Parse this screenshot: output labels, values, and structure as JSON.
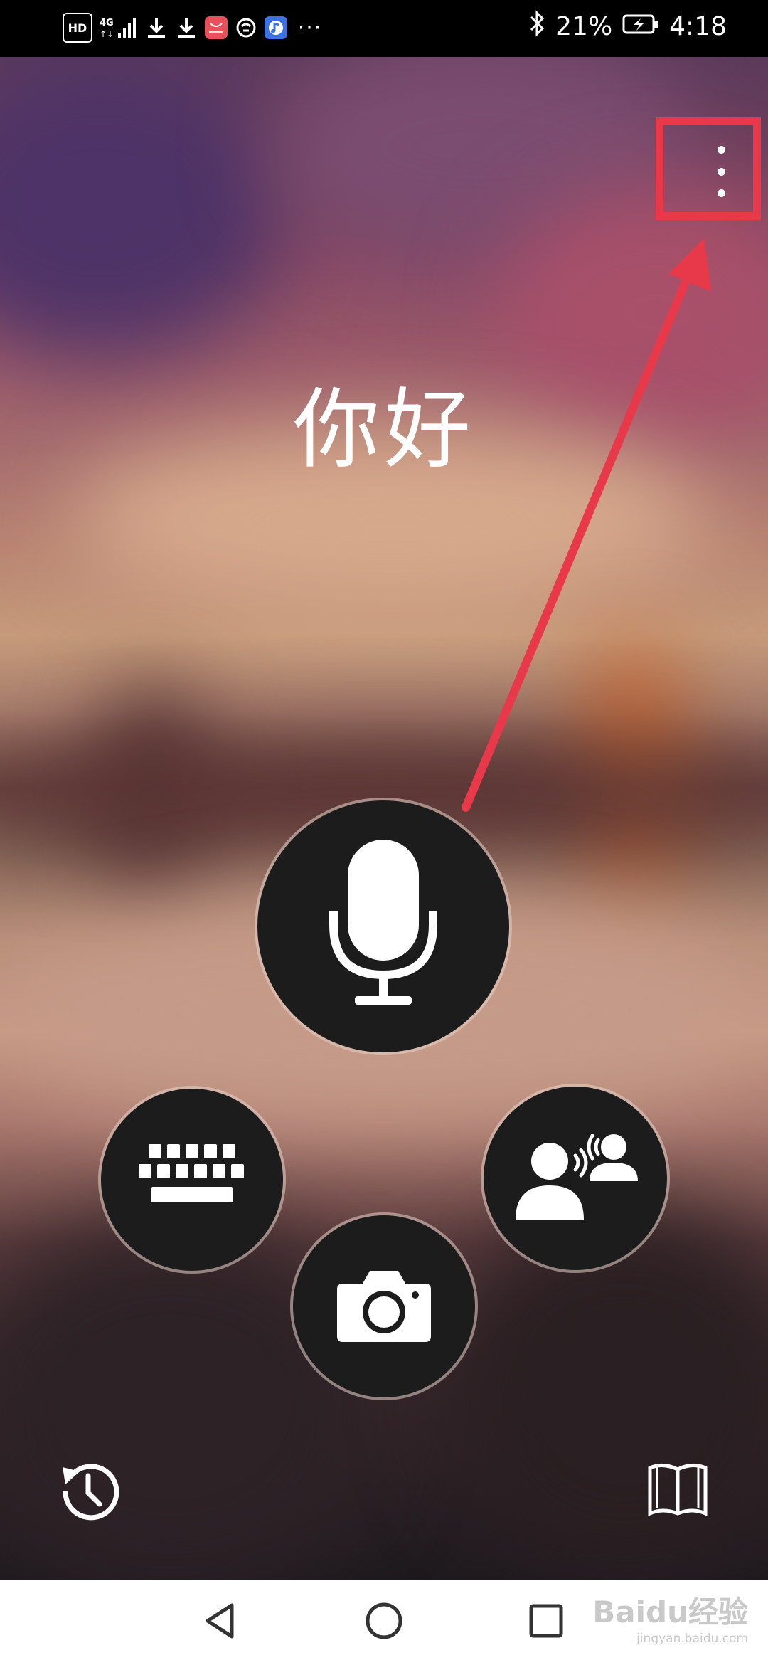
{
  "status_bar": {
    "left_icons": [
      "hd-icon",
      "signal-4g-icon",
      "download-icon",
      "download-icon",
      "huawei-app-icon",
      "vpn-icon",
      "music-app-icon",
      "more-dots-icon"
    ],
    "hd_label": "HD",
    "network_label": "4G",
    "battery_percent": "21%",
    "time": "4:18",
    "overflow": "···"
  },
  "header": {
    "menu_icon": "more-vertical-icon"
  },
  "main": {
    "greeting": "你好"
  },
  "actions": {
    "voice": "microphone-icon",
    "keyboard": "keyboard-icon",
    "conversation": "conversation-icon",
    "camera": "camera-icon"
  },
  "footer": {
    "history": "history-icon",
    "phrasebook": "phrasebook-icon"
  },
  "nav_bar": {
    "back": "back-triangle-icon",
    "home": "home-circle-icon",
    "recent": "recent-square-icon"
  },
  "watermark": {
    "main": "Baidu经验",
    "sub": "jingyan.baidu.com"
  },
  "colors": {
    "annotation_red": "#e8394b",
    "button_dark": "#1c1c1c",
    "nav_background": "#ffffff"
  }
}
